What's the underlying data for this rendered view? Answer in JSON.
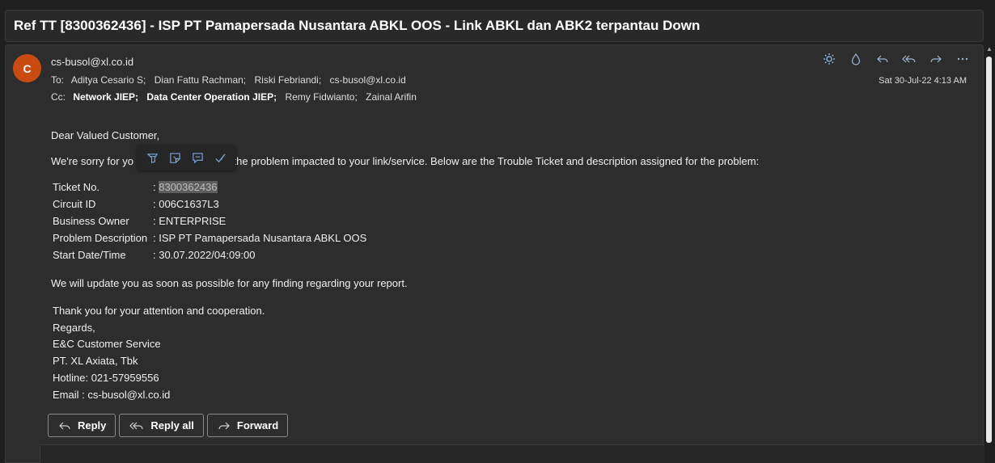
{
  "subject": "Ref TT [8300362436] - ISP PT Pamapersada Nusantara ABKL OOS - Link ABKL dan ABK2 terpantau Down",
  "sender": {
    "avatar_initial": "C",
    "avatar_color": "#c84b12",
    "email": "cs-busol@xl.co.id"
  },
  "to": {
    "label": "To:",
    "recipients": [
      "Aditya Cesario S;",
      "Dian Fattu Rachman;",
      "Riski Febriandi;",
      "cs-busol@xl.co.id"
    ]
  },
  "cc": {
    "label": "Cc:",
    "recipients": [
      "Network JIEP;",
      "Data Center Operation JIEP;",
      "Remy Fidwianto;",
      "Zainal Arifin"
    ]
  },
  "date": "Sat 30-Jul-22 4:13 AM",
  "toolbar": {
    "icons": [
      "sun-icon",
      "drop-icon",
      "reply-icon",
      "reply-all-icon",
      "forward-icon",
      "more-icon"
    ],
    "accent": "#9fb6d4"
  },
  "body": {
    "greeting": "Dear Valued Customer,",
    "sorry_start": "We're sorry for yo",
    "sorry_end": "d for the problem impacted to your link/service. Below are the Trouble Ticket and description assigned for the problem:",
    "ticket": [
      {
        "key": "Ticket No.",
        "value": ": ",
        "highlight": "8300362436"
      },
      {
        "key": "Circuit ID",
        "value": ": 006C1637L3"
      },
      {
        "key": "Business Owner",
        "value": ": ENTERPRISE"
      },
      {
        "key": "Problem Description",
        "value": ": ISP PT Pamapersada Nusantara ABKL OOS"
      },
      {
        "key": "Start Date/Time",
        "value": ": 30.07.2022/04:09:00"
      }
    ],
    "update": "We will update you as soon as possible for any finding regarding your report.",
    "closing": [
      "Thank you for your attention and cooperation.",
      "Regards,",
      "E&C Customer Service",
      "PT. XL Axiata, Tbk",
      "Hotline: 021-57959556",
      "Email : cs-busol@xl.co.id"
    ]
  },
  "actions": {
    "reply": "Reply",
    "reply_all": "Reply all",
    "forward": "Forward"
  }
}
